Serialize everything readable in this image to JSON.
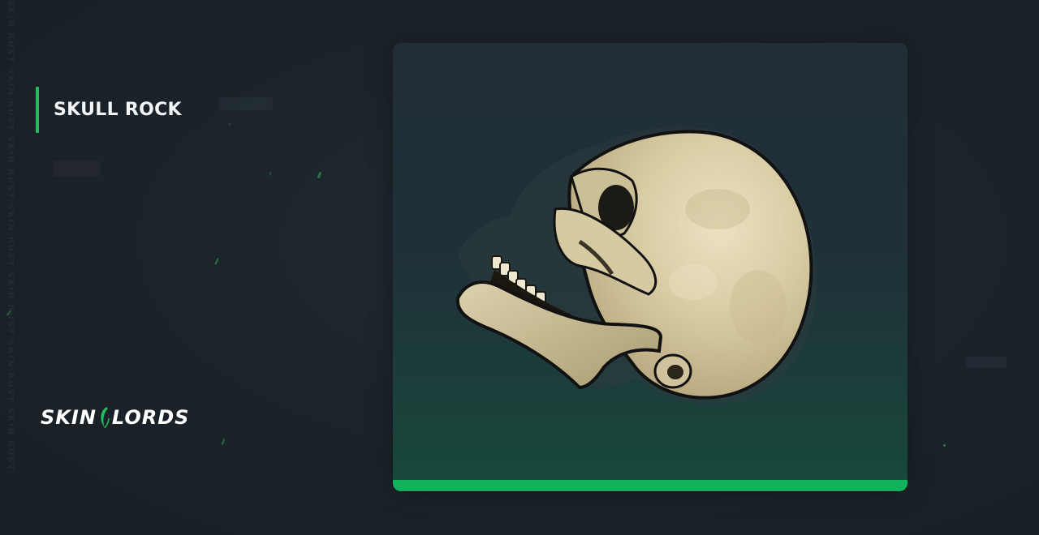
{
  "item": {
    "title": "SKULL ROCK"
  },
  "branding": {
    "logo_left": "SKIN",
    "logo_right": "LORDS",
    "watermark_text": "SKIN RUST SKIN RUST SKIN RUST SKIN RUST SKIN RUST SKIN RUST SKIN RUST"
  },
  "colors": {
    "accent_green": "#13b15b",
    "background": "#1c242b",
    "card_top": "#222e36",
    "card_bottom": "#16493a",
    "title_text": "#f2f4f5"
  },
  "icons": {
    "item_image": "skull-icon",
    "logo_mark": "blade-icon"
  }
}
